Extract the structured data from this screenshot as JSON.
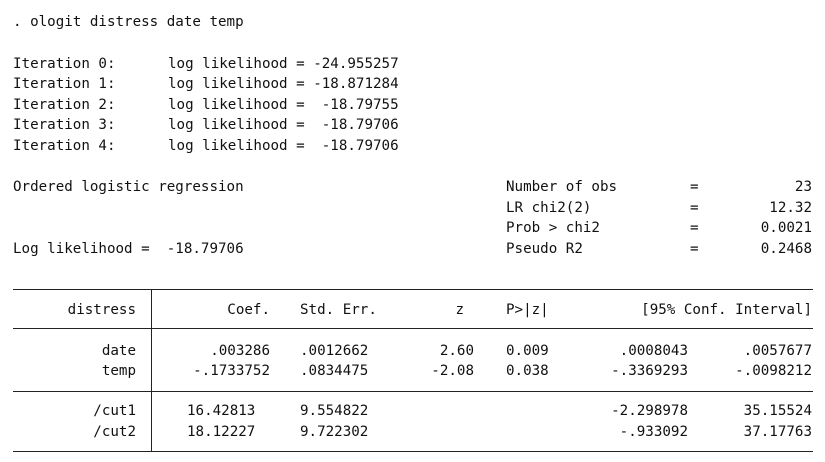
{
  "command": ". ologit distress date temp",
  "iterations": [
    {
      "label": "Iteration 0:",
      "text": "log likelihood = -24.955257"
    },
    {
      "label": "Iteration 1:",
      "text": "log likelihood = -18.871284"
    },
    {
      "label": "Iteration 2:",
      "text": "log likelihood =  -18.79755"
    },
    {
      "label": "Iteration 3:",
      "text": "log likelihood =  -18.79706"
    },
    {
      "label": "Iteration 4:",
      "text": "log likelihood =  -18.79706"
    }
  ],
  "model_title": "Ordered logistic regression",
  "log_likelihood": "Log likelihood =  -18.79706",
  "stats": [
    {
      "label": "Number of obs",
      "eq": "=",
      "value": "23"
    },
    {
      "label": "LR chi2(2)",
      "eq": "=",
      "value": "12.32"
    },
    {
      "label": "Prob > chi2",
      "eq": "=",
      "value": "0.0021"
    },
    {
      "label": "Pseudo R2",
      "eq": "=",
      "value": "0.2468"
    }
  ],
  "table": {
    "headers": {
      "depvar": "distress",
      "coef": "Coef.",
      "se": "Std. Err.",
      "z": "z",
      "p": "P>|z|",
      "ci": "[95% Conf. Interval]"
    },
    "rows": [
      {
        "var": "date",
        "coef": ".003286",
        "se": ".0012662",
        "z": "2.60",
        "p": "0.009",
        "lo": ".0008043",
        "hi": ".0057677"
      },
      {
        "var": "temp",
        "coef": "-.1733752",
        "se": ".0834475",
        "z": "-2.08",
        "p": "0.038",
        "lo": "-.3369293",
        "hi": "-.0098212"
      }
    ],
    "cuts": [
      {
        "var": "/cut1",
        "coef": "16.42813",
        "se": "9.554822",
        "lo": "-2.298978",
        "hi": "35.15524"
      },
      {
        "var": "/cut2",
        "coef": "18.12227",
        "se": "9.722302",
        "lo": "-.933092",
        "hi": "37.17763"
      }
    ]
  }
}
